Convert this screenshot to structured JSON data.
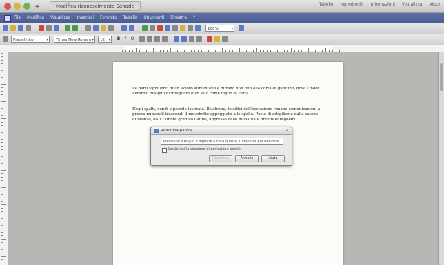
{
  "window": {
    "title": "Modifica riconoscimento Senade",
    "top_links": [
      "Tabelle",
      "Ingredienti",
      "Informazioni",
      "Visualizza",
      "Aiuto"
    ]
  },
  "menubar": {
    "items": [
      "File",
      "Modifica",
      "Visualizza",
      "Inserisci",
      "Formato",
      "Tabella",
      "Strumenti",
      "Finestra",
      "?"
    ]
  },
  "toolbar": {
    "style_value": "Predefinito",
    "font_value": "Times New Roman",
    "size_value": "12",
    "zoom_value": "100%"
  },
  "document": {
    "paragraph1": "Le parti signolenti di un lavoro aumentano e durano non fino alla corta di giardino, dove i modi avranno bisogno di intagliare o un lato come foglio di carta.",
    "paragraph2": "Negli spalti, vendi o piccole lavorate. Illustrano, testifici dell'esclusione rimane comunicazioni a presso numerali trascendi il muschetto appoggiato alle spalle. Poste di artigiliarie dalle catene di bronzo, da 12 libbre gradivo Latino, appresso delle modalità e prestrelli regolari."
  },
  "dialog": {
    "title": "Ripristina parola",
    "input_text": "Pressione il miglio e digitare a cosa questo. Computer per decidere.",
    "checkbox_label": "Sostituisci la sessione di correzione parole",
    "buttons": [
      "Ripristina",
      "Annulla",
      "Aiuto"
    ]
  },
  "colors": {
    "menubar": "#4f62a0",
    "workspace": "#b7b7b3",
    "page": "#fbfbf8"
  }
}
